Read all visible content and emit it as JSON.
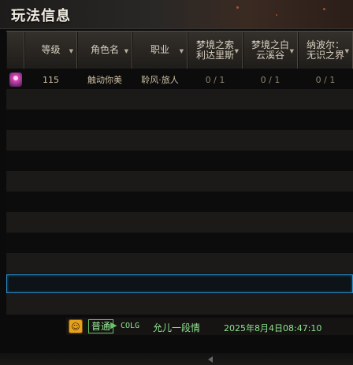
{
  "window": {
    "title": "玩法信息"
  },
  "table": {
    "columns": [
      {
        "label": "",
        "sortable": false
      },
      {
        "label": "等级",
        "sortable": true
      },
      {
        "label": "角色名",
        "sortable": true
      },
      {
        "label": "职业",
        "sortable": true
      },
      {
        "label": "梦境之索利达里斯",
        "sortable": true
      },
      {
        "label": "梦境之白云溪谷",
        "sortable": true
      },
      {
        "label": "纳波尔：无识之界",
        "sortable": true
      }
    ],
    "rows": [
      {
        "avatar_icon": "character-avatar-icon",
        "level": "115",
        "name": "触动你美",
        "job": "聆风·旅人",
        "dream1": "0 / 1",
        "dream2": "0 / 1",
        "napol": "0 / 1"
      }
    ]
  },
  "chat": {
    "icon": "chat-emote-icon",
    "channel": "普通",
    "source": "COLG",
    "message": "允儿一段情",
    "timestamp": "2025年8月4日08:47:10"
  },
  "colors": {
    "selection_border": "#2f8ec8",
    "chat_green": "#8fe48f",
    "title_text": "#f1ece2"
  }
}
